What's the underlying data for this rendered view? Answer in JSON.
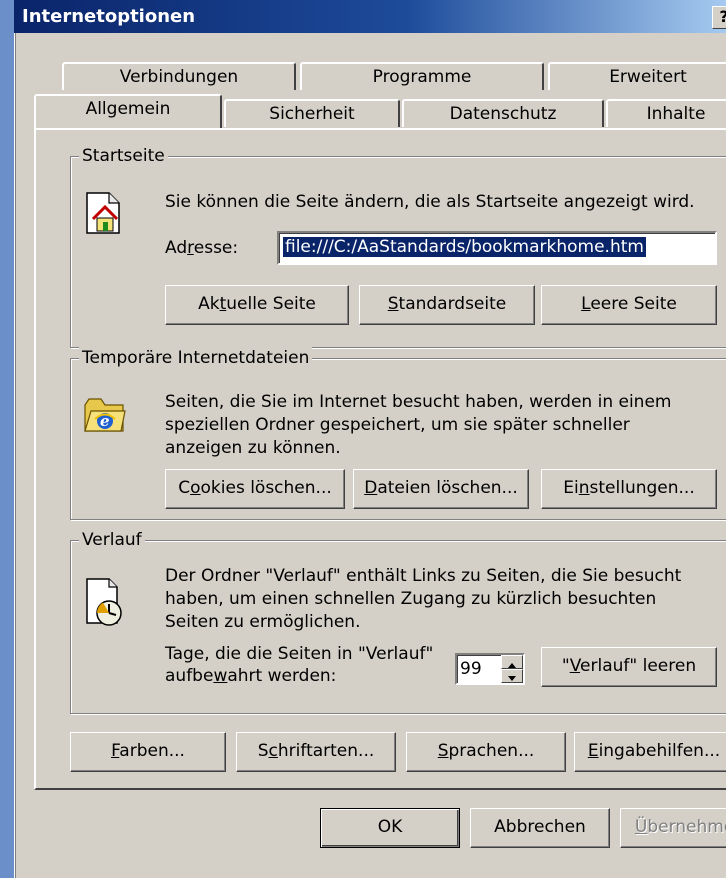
{
  "window": {
    "title": "Internetoptionen",
    "help": "?"
  },
  "tabs": {
    "row_back": [
      "Verbindungen",
      "Programme",
      "Erweitert"
    ],
    "row_front": [
      "Allgemein",
      "Sicherheit",
      "Datenschutz",
      "Inhalte"
    ],
    "selected": "Allgemein"
  },
  "startseite": {
    "legend": "Startseite",
    "description": "Sie können die Seite ändern, die als Startseite angezeigt wird.",
    "address_label_pre": "Ad",
    "address_label_ul": "r",
    "address_label_post": "esse:",
    "address_value": "file:///C:/AaStandards/bookmarkhome.htm",
    "btn_current_pre": "Ak",
    "btn_current_ul": "t",
    "btn_current_post": "uelle Seite",
    "btn_default_pre": "",
    "btn_default_ul": "S",
    "btn_default_post": "tandardseite",
    "btn_empty_pre": "",
    "btn_empty_ul": "L",
    "btn_empty_post": "eere Seite"
  },
  "temp": {
    "legend": "Temporäre Internetdateien",
    "line1": "Seiten, die Sie im Internet besucht haben, werden in einem",
    "line2": "speziellen Ordner gespeichert, um sie später schneller",
    "line3": "anzeigen zu können.",
    "btn_cookies_pre": "C",
    "btn_cookies_ul": "o",
    "btn_cookies_post": "okies löschen...",
    "btn_files_pre": "",
    "btn_files_ul": "D",
    "btn_files_post": "ateien löschen...",
    "btn_settings_pre": "Ei",
    "btn_settings_ul": "n",
    "btn_settings_post": "stellungen..."
  },
  "verlauf": {
    "legend": "Verlauf",
    "line1": "Der Ordner \"Verlauf\" enthält Links zu Seiten, die Sie besucht",
    "line2": "haben, um einen schnellen Zugang zu kürzlich besuchten",
    "line3": "Seiten zu ermöglichen.",
    "days_line1": "Tage, die die Seiten in \"Verlauf\"",
    "days_line2_pre": "aufbe",
    "days_line2_ul": "w",
    "days_line2_post": "ahrt werden:",
    "days_value": "99",
    "btn_clear_pre": "\"",
    "btn_clear_ul": "V",
    "btn_clear_post": "erlauf\" leeren"
  },
  "bottom": {
    "colors_ul": "F",
    "colors_post": "arben...",
    "fonts_pre": "S",
    "fonts_ul": "c",
    "fonts_post": "hriftarten...",
    "lang_ul": "S",
    "lang_post": "prachen...",
    "access_ul": "E",
    "access_post": "ingabehilfen..."
  },
  "dialog": {
    "ok": "OK",
    "cancel": "Abbrechen",
    "apply_ul": "Ü",
    "apply_post": "bernehmen"
  },
  "colors": {
    "titlebar_start": "#0a246a",
    "titlebar_end": "#a6caf0",
    "face": "#d4d0c8",
    "selection": "#0a246a"
  }
}
